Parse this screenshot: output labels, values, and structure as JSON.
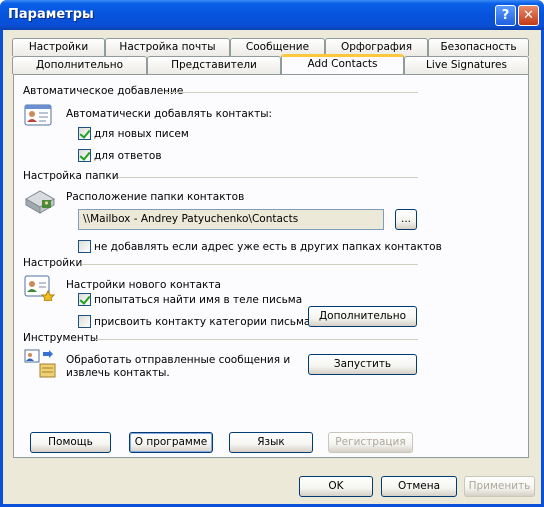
{
  "window": {
    "title": "Параметры"
  },
  "tabs": {
    "row1": [
      "Настройки",
      "Настройка почты",
      "Сообщение",
      "Орфография",
      "Безопасность"
    ],
    "row2": [
      "Дополнительно",
      "Представители",
      "Add Contacts",
      "Live Signatures"
    ]
  },
  "auto_add": {
    "header": "Автоматическое добавление",
    "label": "Автоматически добавлять контакты:",
    "opt_new": "для новых писем",
    "opt_reply": "для ответов"
  },
  "folder": {
    "header": "Настройка папки",
    "label": "Расположение папки контактов",
    "path": "\\\\Mailbox - Andrey Patyuchenko\\Contacts",
    "browse": "...",
    "skip_existing": "не добавлять если адрес уже есть в других папках контактов"
  },
  "settings": {
    "header": "Настройки",
    "label": "Настройки нового контакта",
    "find_name": "попытаться найти имя в теле письма",
    "assign_category": "присвоить контакту категории письма",
    "advanced": "Дополнительно"
  },
  "tools": {
    "header": "Инструменты",
    "description_line1": "Обработать отправленные сообщения и",
    "description_line2": "извлечь контакты.",
    "run": "Запустить"
  },
  "panel_buttons": {
    "help": "Помощь",
    "about": "О программе",
    "language": "Язык",
    "register": "Регистрация"
  },
  "dialog_buttons": {
    "ok": "OK",
    "cancel": "Отмена",
    "apply": "Применить"
  }
}
